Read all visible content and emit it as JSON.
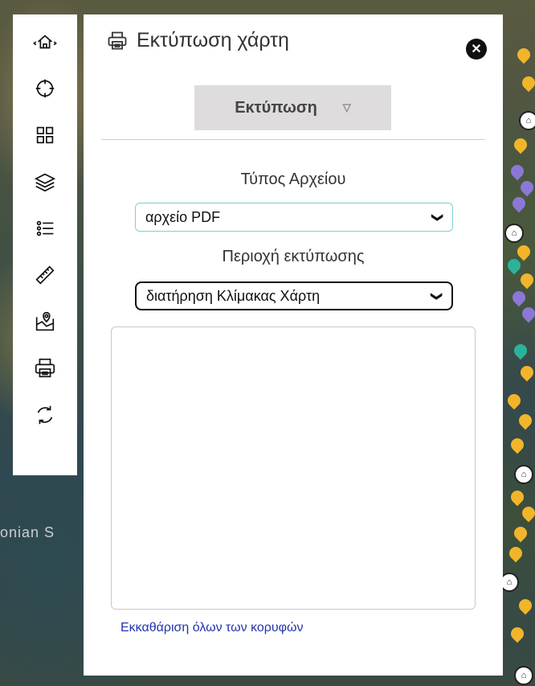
{
  "map": {
    "sea_label": "onian S"
  },
  "toolbar": {
    "tools": [
      {
        "icon": "home-icon"
      },
      {
        "icon": "crosshair-icon"
      },
      {
        "icon": "grid-icon"
      },
      {
        "icon": "layers-icon"
      },
      {
        "icon": "legend-list-icon"
      },
      {
        "icon": "ruler-icon"
      },
      {
        "icon": "map-pin-icon"
      },
      {
        "icon": "printer-icon"
      },
      {
        "icon": "refresh-icon"
      }
    ]
  },
  "panel": {
    "title": "Εκτύπωση χάρτη",
    "title_icon": "printer-icon",
    "close_icon": "close-icon",
    "print_button": {
      "label": "Εκτύπωση",
      "caret": "▽"
    },
    "file_type": {
      "label": "Τύπος Αρχείου",
      "value": "αρχείο PDF"
    },
    "print_area": {
      "label": "Περιοχή εκτύπωσης",
      "value": "διατήρηση Κλίμακας Χάρτη"
    },
    "clear_link": "Εκκαθάριση όλων των κορυφών"
  },
  "colors": {
    "accent_border": "#7ecfd0",
    "link": "#2233aa",
    "marker_yellow": "#f2b52a",
    "marker_purple": "#8b78d6",
    "marker_teal": "#2bb39a"
  }
}
